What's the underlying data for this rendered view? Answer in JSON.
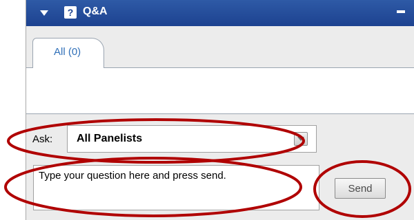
{
  "panel": {
    "title": "Q&A",
    "help_glyph": "?",
    "icons": [
      "collapse-arrow-icon",
      "help-icon",
      "minimize-icon"
    ]
  },
  "tabs": [
    {
      "label": "All (0)",
      "selected": true
    }
  ],
  "ask": {
    "label": "Ask:",
    "selected": "All Panelists"
  },
  "question": {
    "placeholder": "Type your question here and press send."
  },
  "send_label": "Send",
  "colors": {
    "titlebar": "#1d4290",
    "tab_text": "#2f6fb8",
    "annotation": "#b00000"
  }
}
